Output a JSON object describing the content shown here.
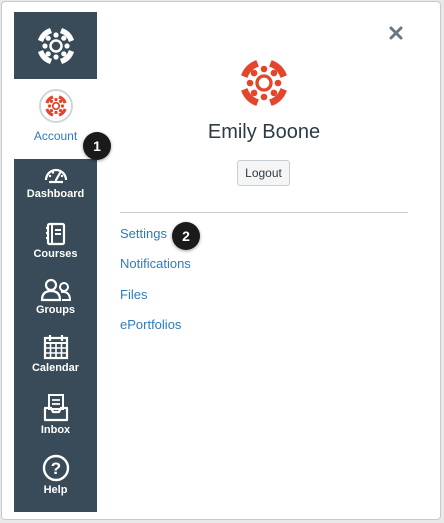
{
  "nav": {
    "account_label": "Account",
    "items": [
      {
        "label": "Dashboard",
        "icon": "dashboard-icon"
      },
      {
        "label": "Courses",
        "icon": "courses-icon"
      },
      {
        "label": "Groups",
        "icon": "groups-icon"
      },
      {
        "label": "Calendar",
        "icon": "calendar-icon"
      },
      {
        "label": "Inbox",
        "icon": "inbox-icon"
      },
      {
        "label": "Help",
        "icon": "help-icon"
      }
    ]
  },
  "callouts": {
    "one": "1",
    "two": "2"
  },
  "profile": {
    "name": "Emily Boone",
    "logout_label": "Logout",
    "links": [
      "Settings",
      "Notifications",
      "Files",
      "ePortfolios"
    ]
  },
  "colors": {
    "nav_bg": "#394b58",
    "link": "#2d7bbf",
    "brand_red": "#e3462c"
  }
}
